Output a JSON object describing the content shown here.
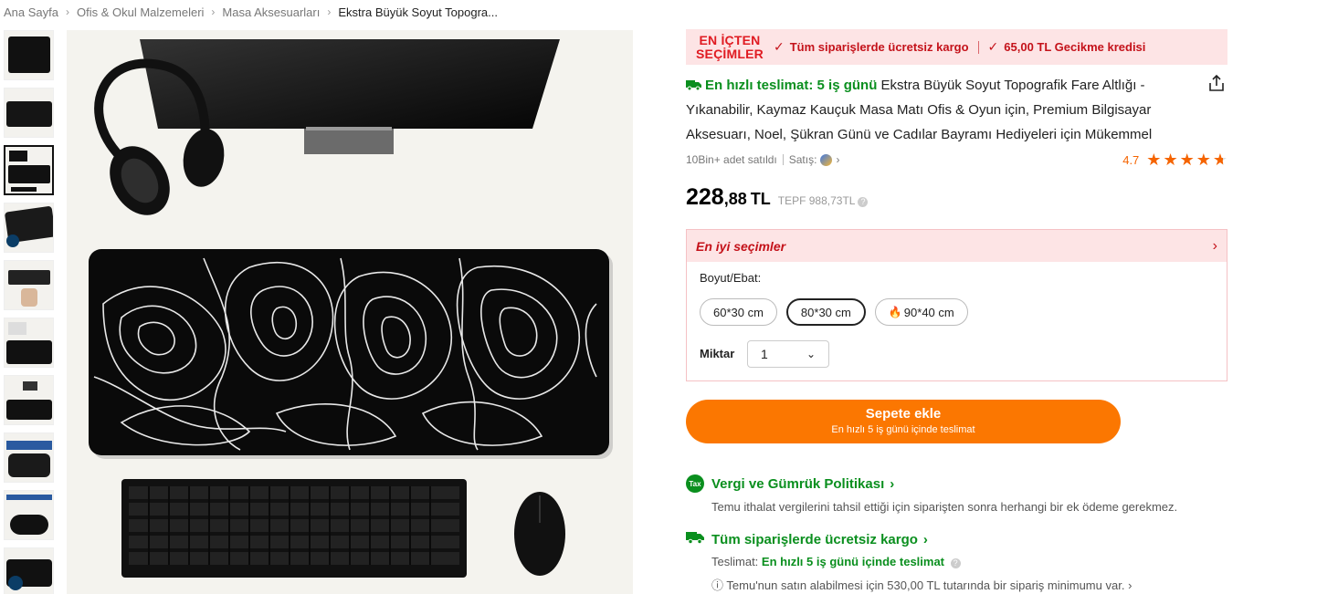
{
  "breadcrumb": {
    "items": [
      "Ana Sayfa",
      "Ofis & Okul Malzemeleri",
      "Masa Aksesuarları",
      "Ekstra Büyük Soyut Topogra..."
    ]
  },
  "banner": {
    "logo_line1": "EN İÇTEN",
    "logo_line2": "SEÇİMLER",
    "item1": "Tüm siparişlerde ücretsiz kargo",
    "item2": "65,00 TL Gecikme kredisi"
  },
  "product": {
    "fast_delivery": "En hızlı teslimat: 5 iş günü",
    "title": "Ekstra Büyük Soyut Topografik Fare Altlığı - Yıkanabilir, Kaymaz Kauçuk Masa Matı Ofis & Oyun için, Premium Bilgisayar Aksesuarı, Noel, Şükran Günü ve Cadılar Bayramı Hediyeleri için Mükemmel",
    "sold": "10Bin+ adet satıldı",
    "seller_label": "Satış:",
    "rating": "4.7",
    "star_count": 4.7,
    "price_int": "228",
    "price_dec": ",88",
    "currency": "TL",
    "old_price": "TEPF 988,73TL"
  },
  "options": {
    "header": "En iyi seçimler",
    "size_label": "Boyut/Ebat:",
    "sizes": [
      "60*30 cm",
      "80*30 cm",
      "90*40 cm"
    ],
    "selected_size": "80*30 cm",
    "qty_label": "Miktar",
    "qty_value": "1"
  },
  "cart": {
    "label": "Sepete ekle",
    "sub": "En hızlı 5 iş günü içinde teslimat"
  },
  "policies": {
    "tax_title": "Vergi ve Gümrük Politikası",
    "tax_desc": "Temu ithalat vergilerini tahsil ettiği için siparişten sonra herhangi bir ek ödeme gerekmez.",
    "shipping_title": "Tüm siparişlerde ücretsiz kargo",
    "delivery_label": "Teslimat:",
    "delivery_value": "En hızlı 5 iş günü içinde teslimat",
    "min_order": "Temu'nun satın alabilmesi için 530,00 TL tutarında bir sipariş minimumu var."
  },
  "icons": {
    "tax_icon_text": "Tax"
  },
  "colors": {
    "accent_orange": "#fb7701",
    "green": "#0a8f1e",
    "red": "#c4121a",
    "banner_bg": "#fde4e5"
  }
}
